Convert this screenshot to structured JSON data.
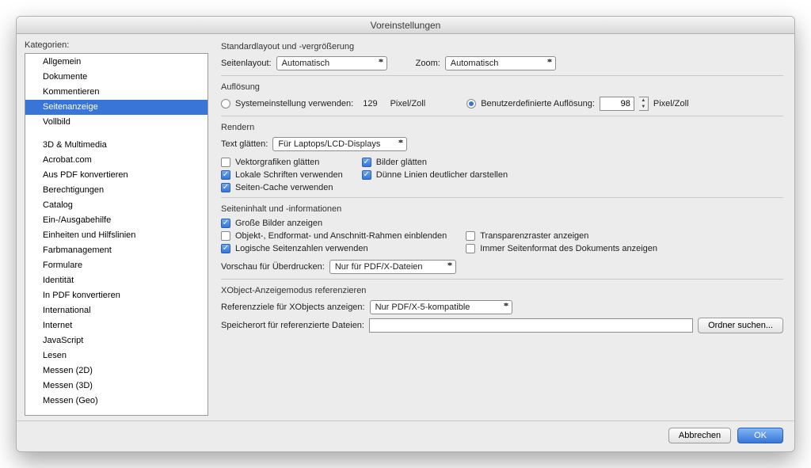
{
  "window": {
    "title": "Voreinstellungen"
  },
  "sidebar": {
    "label": "Kategorien:",
    "items": [
      {
        "label": "Allgemein",
        "sel": false
      },
      {
        "label": "Dokumente",
        "sel": false
      },
      {
        "label": "Kommentieren",
        "sel": false
      },
      {
        "label": "Seitenanzeige",
        "sel": true
      },
      {
        "label": "Vollbild",
        "sel": false
      },
      {
        "label": "",
        "sep": true
      },
      {
        "label": "3D & Multimedia",
        "sel": false
      },
      {
        "label": "Acrobat.com",
        "sel": false
      },
      {
        "label": "Aus PDF konvertieren",
        "sel": false
      },
      {
        "label": "Berechtigungen",
        "sel": false
      },
      {
        "label": "Catalog",
        "sel": false
      },
      {
        "label": "Ein-/Ausgabehilfe",
        "sel": false
      },
      {
        "label": "Einheiten und Hilfslinien",
        "sel": false
      },
      {
        "label": "Farbmanagement",
        "sel": false
      },
      {
        "label": "Formulare",
        "sel": false
      },
      {
        "label": "Identität",
        "sel": false
      },
      {
        "label": "In PDF konvertieren",
        "sel": false
      },
      {
        "label": "International",
        "sel": false
      },
      {
        "label": "Internet",
        "sel": false
      },
      {
        "label": "JavaScript",
        "sel": false
      },
      {
        "label": "Lesen",
        "sel": false
      },
      {
        "label": "Messen (2D)",
        "sel": false
      },
      {
        "label": "Messen (3D)",
        "sel": false
      },
      {
        "label": "Messen (Geo)",
        "sel": false
      }
    ]
  },
  "layout": {
    "title": "Standardlayout und -vergrößerung",
    "pageLayout_label": "Seitenlayout:",
    "pageLayout_value": "Automatisch",
    "zoom_label": "Zoom:",
    "zoom_value": "Automatisch"
  },
  "resolution": {
    "title": "Auflösung",
    "system_label": "Systemeinstellung verwenden:",
    "system_value": "129",
    "ppi": "Pixel/Zoll",
    "custom_label": "Benutzerdefinierte Auflösung:",
    "custom_value": "98",
    "selected": "custom"
  },
  "render": {
    "title": "Rendern",
    "textsmooth_label": "Text glätten:",
    "textsmooth_value": "Für Laptops/LCD-Displays",
    "vector": {
      "label": "Vektorgrafiken glätten",
      "on": false
    },
    "images": {
      "label": "Bilder glätten",
      "on": true
    },
    "localfonts": {
      "label": "Lokale Schriften verwenden",
      "on": true
    },
    "thinlines": {
      "label": "Dünne Linien deutlicher darstellen",
      "on": true
    },
    "pagecache": {
      "label": "Seiten-Cache verwenden",
      "on": true
    }
  },
  "pagecontent": {
    "title": "Seiteninhalt und -informationen",
    "bigimages": {
      "label": "Große Bilder anzeigen",
      "on": true
    },
    "boxes": {
      "label": "Objekt-, Endformat- und Anschnitt-Rahmen einblenden",
      "on": false
    },
    "transp": {
      "label": "Transparenzraster anzeigen",
      "on": false
    },
    "logical": {
      "label": "Logische Seitenzahlen verwenden",
      "on": true
    },
    "format": {
      "label": "Immer Seitenformat des Dokuments anzeigen",
      "on": false
    },
    "overprint_label": "Vorschau für Überdrucken:",
    "overprint_value": "Nur für PDF/X-Dateien"
  },
  "xobject": {
    "title": "XObject-Anzeigemodus referenzieren",
    "targets_label": "Referenzziele für XObjects anzeigen:",
    "targets_value": "Nur PDF/X-5-kompatible",
    "storage_label": "Speicherort für referenzierte Dateien:",
    "storage_value": "",
    "browse": "Ordner suchen..."
  },
  "footer": {
    "cancel": "Abbrechen",
    "ok": "OK"
  }
}
